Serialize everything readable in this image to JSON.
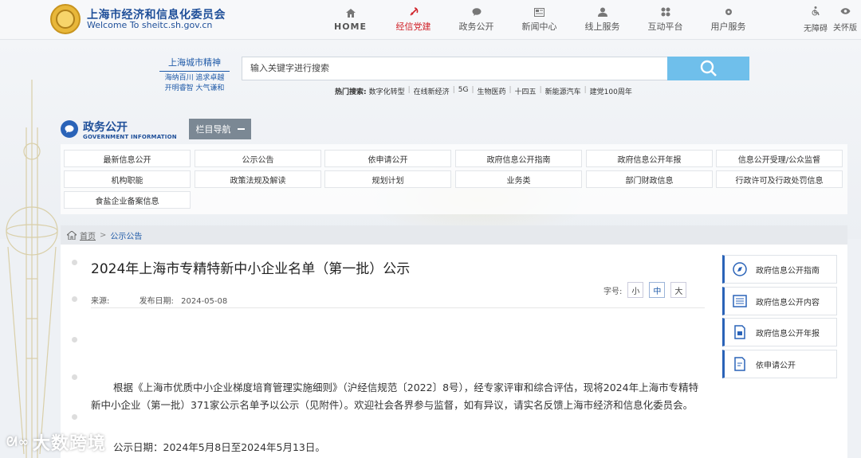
{
  "header": {
    "site_title": "上海市经济和信息化委员会",
    "site_url": "Welcome To sheitc.sh.gov.cn",
    "nav": [
      {
        "label": "HOME",
        "icon": "home-icon"
      },
      {
        "label": "经信党建",
        "icon": "party-emblem-icon",
        "active": true
      },
      {
        "label": "政务公开",
        "icon": "speech-bubble-icon"
      },
      {
        "label": "新闻中心",
        "icon": "newspaper-icon"
      },
      {
        "label": "线上服务",
        "icon": "user-service-icon"
      },
      {
        "label": "互动平台",
        "icon": "grid-icon"
      },
      {
        "label": "用户服务",
        "icon": "gear-icon"
      }
    ],
    "accessibility_label": "无障碍",
    "care_label": "关怀版"
  },
  "search": {
    "motto_title": "上海城市精神",
    "motto_line1": "海纳百川 追求卓越",
    "motto_line2": "开明睿智 大气谦和",
    "placeholder": "输入关键字进行搜索",
    "hot_label": "热门搜索:",
    "hot_terms": [
      "数字化转型",
      "在线新经济",
      "5G",
      "生物医药",
      "十四五",
      "新能源汽车",
      "建党100周年"
    ]
  },
  "section": {
    "title": "政务公开",
    "subtitle": "GOVERNMENT INFORMATION",
    "column_nav": "栏目导航"
  },
  "categories": [
    "最新信息公开",
    "公示公告",
    "依申请公开",
    "政府信息公开指南",
    "政府信息公开年报",
    "信息公开受理/公众监督",
    "机构职能",
    "政策法规及解读",
    "规划计划",
    "业务类",
    "部门财政信息",
    "行政许可及行政处罚信息",
    "食盐企业备案信息"
  ],
  "breadcrumb": {
    "home": "首页",
    "sep": ">",
    "current": "公示公告"
  },
  "article": {
    "title": "2024年上海市专精特新中小企业名单（第一批）公示",
    "source_label": "来源:",
    "date_label": "发布日期:",
    "date": "2024-05-08",
    "fontsize_label": "字号:",
    "fontsize_small": "小",
    "fontsize_medium": "中",
    "fontsize_large": "大",
    "paragraph": "根据《上海市优质中小企业梯度培育管理实施细则》（沪经信规范〔2022〕8号），经专家评审和综合评估，现将2024年上海市专精特新中小企业（第一批）371家公示名单予以公示（见附件）。欢迎社会各界参与监督，如有异议，请实名反馈上海市经济和信息化委员会。",
    "pub_period": "公示日期：2024年5月8日至2024年5月13日。"
  },
  "sidebar": [
    {
      "label": "政府信息公开指南",
      "icon": "compass-icon"
    },
    {
      "label": "政府信息公开内容",
      "icon": "list-icon"
    },
    {
      "label": "政府信息公开年报",
      "icon": "report-icon"
    },
    {
      "label": "依申请公开",
      "icon": "edit-form-icon"
    }
  ],
  "watermark": "大数跨境",
  "colors": {
    "brand_blue": "#1f4f99",
    "accent_red": "#d0232a",
    "search_button": "#6fbfeb",
    "column_nav_bg": "#7b8894"
  }
}
